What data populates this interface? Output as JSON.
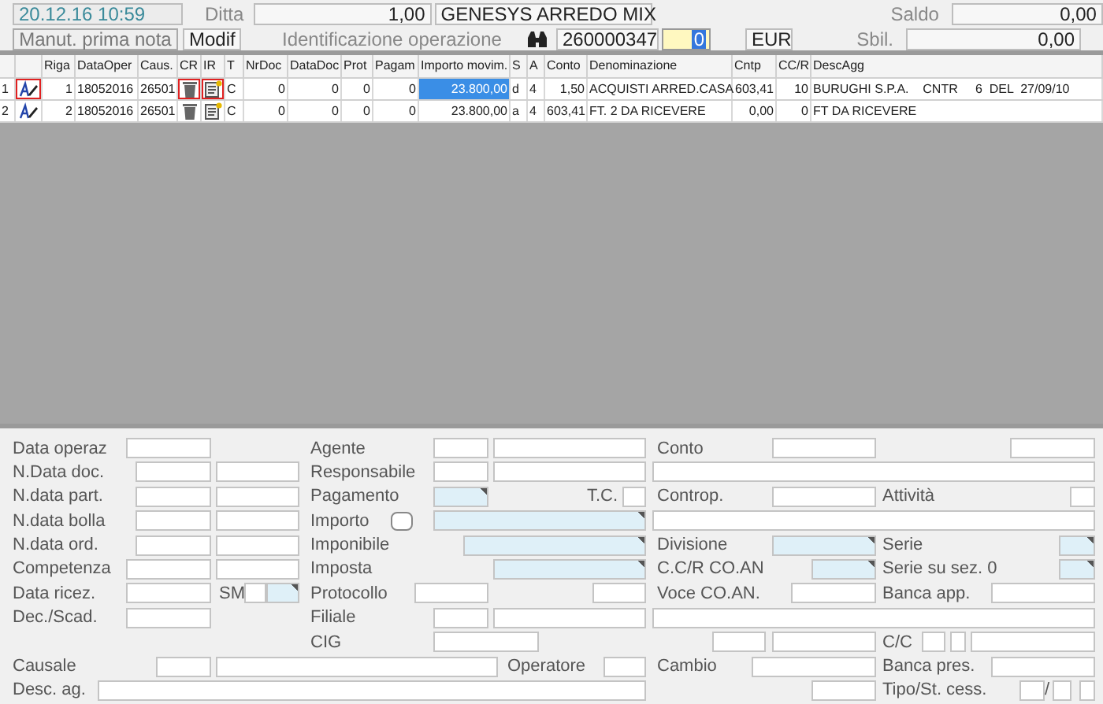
{
  "header": {
    "datetime": "20.12.16 10:59",
    "company_label": "Ditta",
    "company_code": "1,00",
    "company_name": "GENESYS ARREDO MIX",
    "saldo_label": "Saldo",
    "saldo": "0,00",
    "mode_button": "Manut. prima nota",
    "mode": "Modif",
    "operation_label": "Identificazione operazione",
    "operation_number": "260000347",
    "operation_suffix": "0",
    "currency": "EUR",
    "sbil_label": "Sbil.",
    "sbil": "0,00"
  },
  "table": {
    "columns": [
      {
        "label": "Riga",
        "kind": "text"
      },
      {
        "label": "DataOper",
        "kind": "text"
      },
      {
        "label": "Caus.",
        "kind": "text"
      },
      {
        "label": "CR",
        "kind": "delete"
      },
      {
        "label": "IR",
        "kind": "attach"
      },
      {
        "label": "T",
        "kind": "text"
      },
      {
        "label": "NrDoc",
        "kind": "text"
      },
      {
        "label": "DataDoc",
        "kind": "text"
      },
      {
        "label": "Prot",
        "kind": "text"
      },
      {
        "label": "Pagam",
        "kind": "text"
      },
      {
        "label": "Importo movim.",
        "kind": "text"
      },
      {
        "label": "S",
        "kind": "text"
      },
      {
        "label": "A",
        "kind": "text"
      },
      {
        "label": "Conto",
        "kind": "text"
      },
      {
        "label": "Denominazione",
        "kind": "text"
      },
      {
        "label": "Cntp",
        "kind": "text"
      },
      {
        "label": "CC/R",
        "kind": "text"
      },
      {
        "label": "DescAgg",
        "kind": "text"
      }
    ],
    "rows": [
      {
        "number": "1",
        "selected": true,
        "cells": [
          "1",
          "18052016",
          "26501",
          "",
          "",
          "C",
          "0",
          "0",
          "0",
          "0",
          "23.800,00",
          "d",
          "4",
          "1,50",
          "ACQUISTI ARRED.CASA",
          "603,41",
          "10",
          "BURUGHI S.P.A.    CNTR     6  DEL  27/09/10"
        ]
      },
      {
        "number": "2",
        "selected": false,
        "cells": [
          "2",
          "18052016",
          "26501",
          "",
          "",
          "C",
          "0",
          "0",
          "0",
          "0",
          "23.800,00",
          "a",
          "4",
          "603,41",
          "FT. 2 DA RICEVERE",
          "0,00",
          "0",
          "FT DA RICEVERE"
        ]
      }
    ]
  },
  "form": {
    "rows": [
      {
        "items": [
          {
            "kind": "label",
            "text": "Data operaz"
          },
          {
            "kind": "field"
          },
          {
            "kind": "label",
            "text": "Agente"
          },
          {
            "kind": "field"
          },
          {
            "kind": "field"
          },
          {
            "kind": "label",
            "text": "Conto"
          },
          {
            "kind": "field"
          },
          {
            "kind": "field"
          }
        ]
      },
      {
        "items": [
          {
            "kind": "label",
            "text": "N.Data doc."
          },
          {
            "kind": "field"
          },
          {
            "kind": "field"
          },
          {
            "kind": "label",
            "text": "Responsabile"
          },
          {
            "kind": "field"
          },
          {
            "kind": "field"
          },
          {
            "kind": "field"
          }
        ]
      },
      {
        "items": [
          {
            "kind": "label",
            "text": "N.data part."
          },
          {
            "kind": "field"
          },
          {
            "kind": "field"
          },
          {
            "kind": "label",
            "text": "Pagamento"
          },
          {
            "kind": "lookup"
          },
          {
            "kind": "label",
            "text": "T.C."
          },
          {
            "kind": "field"
          },
          {
            "kind": "label",
            "text": "Controp."
          },
          {
            "kind": "field"
          },
          {
            "kind": "label",
            "text": "Attività"
          },
          {
            "kind": "field"
          }
        ]
      },
      {
        "items": [
          {
            "kind": "label",
            "text": "N.data bolla"
          },
          {
            "kind": "field"
          },
          {
            "kind": "field"
          },
          {
            "kind": "label",
            "text": "Importo"
          },
          {
            "kind": "toggle"
          },
          {
            "kind": "lookup"
          },
          {
            "kind": "field"
          }
        ]
      },
      {
        "items": [
          {
            "kind": "label",
            "text": "N.data ord."
          },
          {
            "kind": "field"
          },
          {
            "kind": "field"
          },
          {
            "kind": "label",
            "text": "Imponibile"
          },
          {
            "kind": "lookup"
          },
          {
            "kind": "label",
            "text": "Divisione"
          },
          {
            "kind": "lookup"
          },
          {
            "kind": "label",
            "text": "Serie"
          },
          {
            "kind": "lookup"
          }
        ]
      },
      {
        "items": [
          {
            "kind": "label",
            "text": "Competenza"
          },
          {
            "kind": "field"
          },
          {
            "kind": "field"
          },
          {
            "kind": "label",
            "text": "Imposta"
          },
          {
            "kind": "lookup"
          },
          {
            "kind": "label",
            "text": "C.C/R CO.AN"
          },
          {
            "kind": "lookup"
          },
          {
            "kind": "label",
            "text": "Serie su sez. 0"
          },
          {
            "kind": "lookup"
          }
        ]
      },
      {
        "items": [
          {
            "kind": "label",
            "text": "Data ricez."
          },
          {
            "kind": "field"
          },
          {
            "kind": "label",
            "text": "SM"
          },
          {
            "kind": "field"
          },
          {
            "kind": "lookup"
          },
          {
            "kind": "label",
            "text": "Protocollo"
          },
          {
            "kind": "field"
          },
          {
            "kind": "field"
          },
          {
            "kind": "label",
            "text": "Voce CO.AN."
          },
          {
            "kind": "field"
          },
          {
            "kind": "label",
            "text": "Banca app."
          },
          {
            "kind": "field"
          }
        ]
      },
      {
        "items": [
          {
            "kind": "label",
            "text": "Dec./Scad."
          },
          {
            "kind": "field"
          },
          {
            "kind": "label",
            "text": "Filiale"
          },
          {
            "kind": "field"
          },
          {
            "kind": "field"
          },
          {
            "kind": "field"
          }
        ]
      },
      {
        "items": [
          {
            "kind": "label",
            "text": "CIG"
          },
          {
            "kind": "field"
          },
          {
            "kind": "field"
          },
          {
            "kind": "field"
          },
          {
            "kind": "label",
            "text": "C/C"
          },
          {
            "kind": "field"
          },
          {
            "kind": "field"
          },
          {
            "kind": "field"
          }
        ]
      },
      {
        "items": [
          {
            "kind": "label",
            "text": "Causale"
          },
          {
            "kind": "field"
          },
          {
            "kind": "field"
          },
          {
            "kind": "label",
            "text": "Operatore"
          },
          {
            "kind": "field"
          },
          {
            "kind": "label",
            "text": "Cambio"
          },
          {
            "kind": "field"
          },
          {
            "kind": "label",
            "text": "Banca pres."
          },
          {
            "kind": "field"
          }
        ]
      },
      {
        "items": [
          {
            "kind": "label",
            "text": "Desc. ag."
          },
          {
            "kind": "field"
          },
          {
            "kind": "field"
          },
          {
            "kind": "label",
            "text": "Tipo/St. cess."
          },
          {
            "kind": "field"
          },
          {
            "kind": "label",
            "text": "/"
          },
          {
            "kind": "field"
          },
          {
            "kind": "field"
          }
        ]
      }
    ]
  }
}
